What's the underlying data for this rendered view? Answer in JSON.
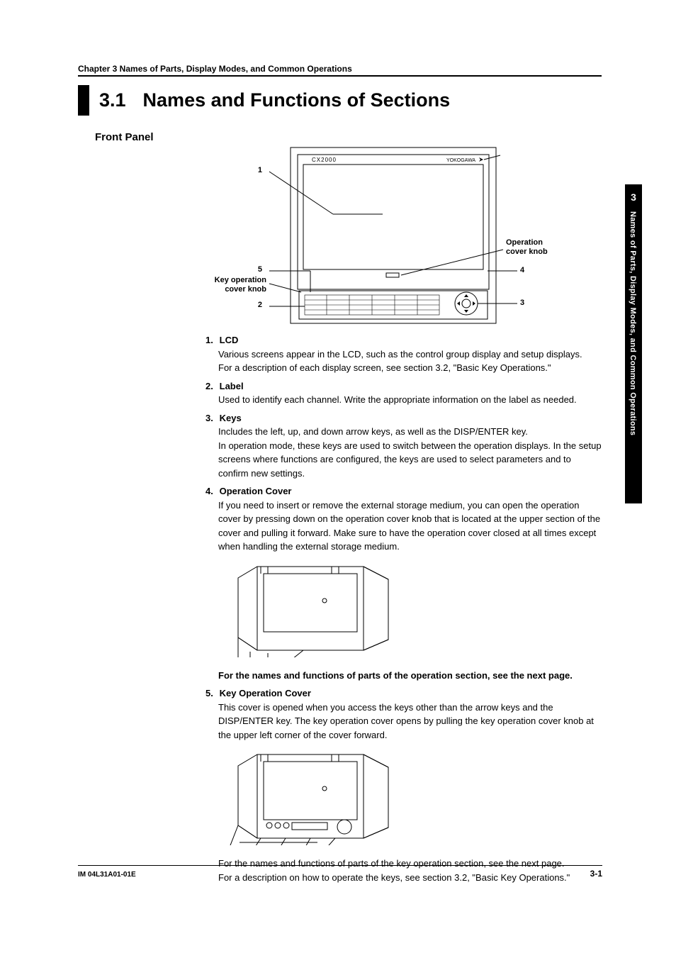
{
  "header": {
    "chapter_line": "Chapter 3   Names of Parts, Display Modes, and Common Operations",
    "section_number": "3.1",
    "section_title": "Names and Functions of Sections"
  },
  "side_tab": {
    "number": "3",
    "text": "Names of Parts, Display Modes, and Common Operations"
  },
  "subhead": "Front Panel",
  "figure": {
    "model_label": "CX2000",
    "brand_label": "YOKOGAWA",
    "callouts": {
      "c1": "1",
      "c5": "5",
      "key_op_label_l1": "Key operation",
      "key_op_label_l2": "cover knob",
      "c2": "2",
      "op_label_l1": "Operation",
      "op_label_l2": "cover knob",
      "c4": "4",
      "c3": "3"
    }
  },
  "items": [
    {
      "num": "1.",
      "title": "LCD",
      "body": [
        "Various screens appear in the LCD, such as the control group display and setup displays.",
        "For a description of each display screen, see section 3.2, \"Basic Key Operations.\""
      ]
    },
    {
      "num": "2.",
      "title": "Label",
      "body": [
        "Used to identify each channel. Write the appropriate information on the label as needed."
      ]
    },
    {
      "num": "3.",
      "title": "Keys",
      "body": [
        "Includes the left, up, and down arrow keys, as well as the DISP/ENTER key.",
        "In operation mode, these keys are used to switch between the operation displays.  In the setup screens where functions are configured, the keys are used to select parameters and to confirm new settings."
      ]
    },
    {
      "num": "4.",
      "title": "Operation Cover",
      "body": [
        "If you need to insert or remove the external storage medium, you can open the operation cover by pressing down on the operation cover knob that is located at the upper section of the cover and pulling it forward.  Make sure to have the operation cover closed at all times except when handling the external storage medium."
      ],
      "has_diagram": true,
      "trailer_bold": "For the names and functions of parts of the operation section, see the next page."
    },
    {
      "num": "5.",
      "title": "Key Operation Cover",
      "body": [
        "This cover is opened when you access the keys other than the arrow keys and the DISP/ENTER key.  The key operation cover opens by pulling the key operation cover knob at the upper left corner of the cover forward."
      ],
      "has_diagram": true,
      "trailer_lines": [
        "For the names and functions of parts of the key operation section, see the next page.",
        "For a description on how to operate the keys, see section 3.2, \"Basic Key Operations.\""
      ]
    }
  ],
  "footer": {
    "left": "IM 04L31A01-01E",
    "right": "3-1"
  }
}
